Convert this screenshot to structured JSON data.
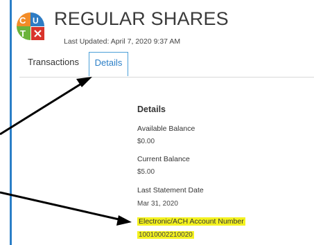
{
  "header": {
    "title": "REGULAR SHARES",
    "last_updated": "Last Updated: April 7, 2020 9:37 AM"
  },
  "tabs": [
    {
      "label": "Transactions"
    },
    {
      "label": "Details"
    }
  ],
  "details": {
    "heading": "Details",
    "items": [
      {
        "label": "Available Balance",
        "value": "$0.00"
      },
      {
        "label": "Current Balance",
        "value": "$5.00"
      },
      {
        "label": "Last Statement Date",
        "value": "Mar 31, 2020"
      },
      {
        "label": "Electronic/ACH Account Number",
        "value": "10010002210020"
      }
    ]
  },
  "colors": {
    "accent": "#2b7fc7",
    "highlight": "#f4f21f",
    "logo_orange": "#f28c28",
    "logo_blue": "#2e7cc4",
    "logo_green": "#6bb33b",
    "logo_red": "#d9342b"
  }
}
